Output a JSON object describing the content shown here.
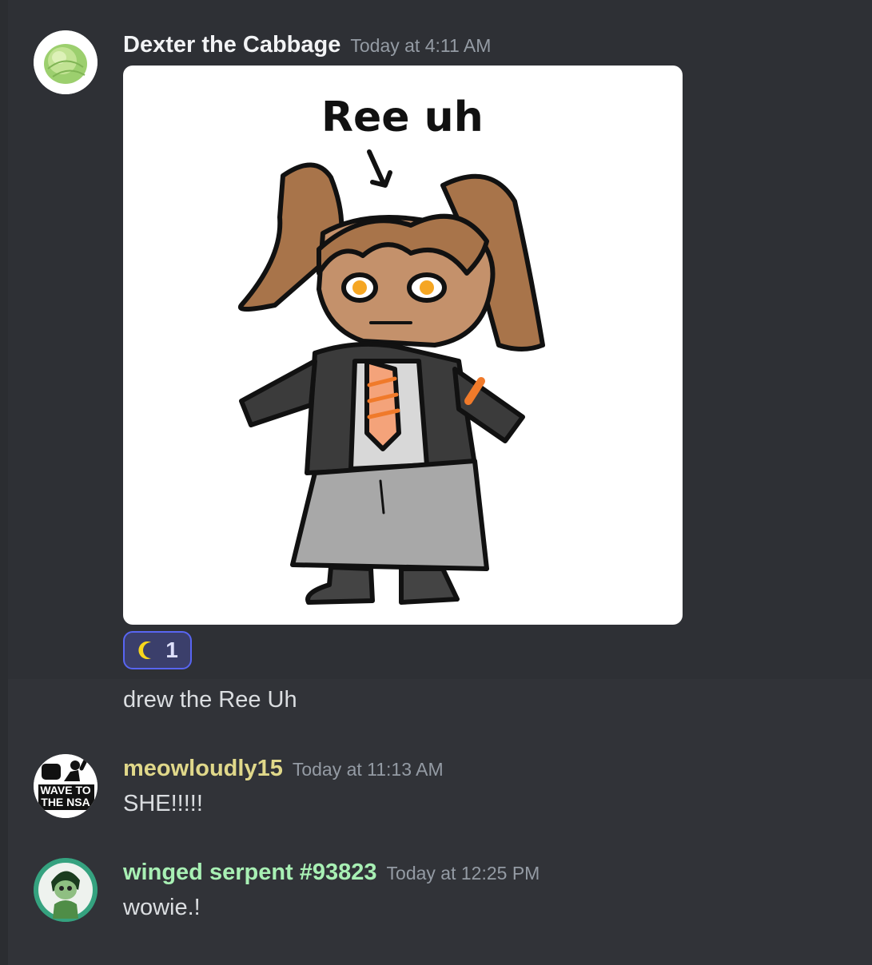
{
  "messages": [
    {
      "author": "Dexter the Cabbage",
      "author_color": "#f2f3f5",
      "timestamp": "Today at 4:11 AM",
      "avatar": "cabbage-avatar",
      "attachment": {
        "type": "image",
        "drawing_label": "Ree uh"
      },
      "reaction": {
        "emoji": "crescent-moon-icon",
        "count": "1"
      },
      "text": "drew the Ree Uh"
    },
    {
      "author": "meowloudly15",
      "author_color": "#e0d88a",
      "timestamp": "Today at 11:13 AM",
      "avatar": "wave-to-the-nsa-avatar",
      "avatar_text": [
        "WAVE TO",
        "THE NSA"
      ],
      "text": "SHE!!!!!"
    },
    {
      "author": "winged serpent #93823",
      "author_color": "#a8f0b4",
      "timestamp": "Today at 12:25 PM",
      "avatar": "green-character-avatar",
      "text": "wowie.!"
    }
  ]
}
